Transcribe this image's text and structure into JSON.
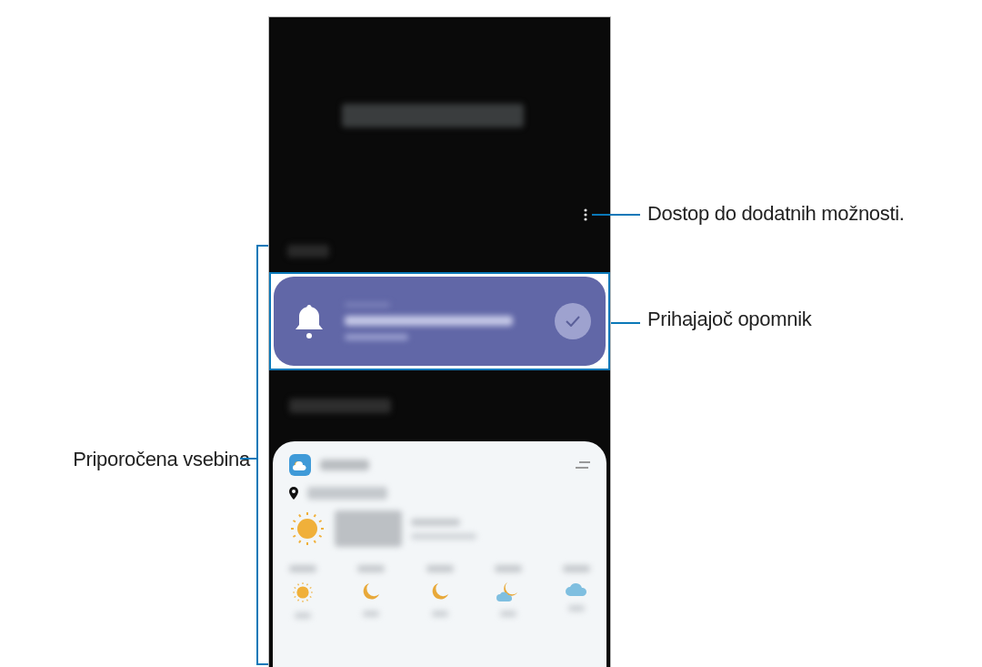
{
  "callouts": [
    {
      "kind": "menu",
      "text": "Dostop do dodatnih možnosti."
    },
    {
      "kind": "reminder",
      "text": "Prihajajoč opomnik"
    },
    {
      "kind": "content",
      "text": "Priporočena vsebina"
    }
  ],
  "weather": {
    "forecast": [
      {
        "kind": "sun"
      },
      {
        "kind": "moon"
      },
      {
        "kind": "moon"
      },
      {
        "kind": "moon-cloud"
      },
      {
        "kind": "cloud"
      }
    ]
  }
}
